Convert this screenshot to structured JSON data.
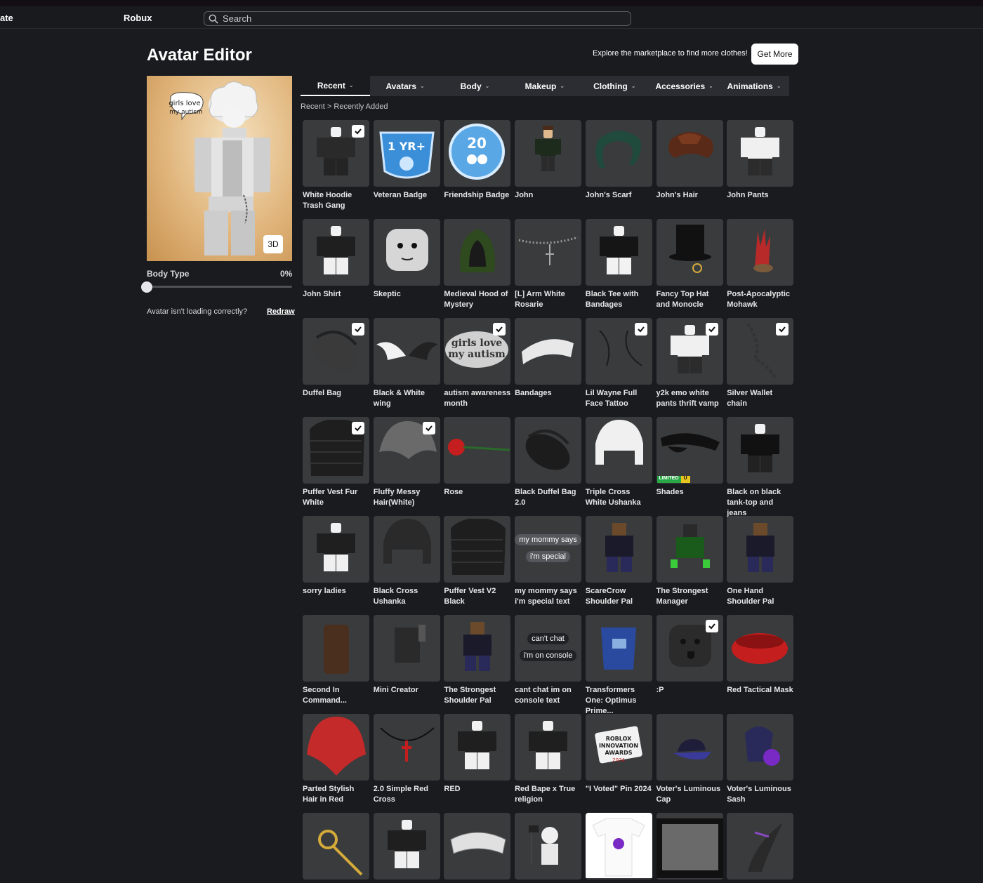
{
  "nav": {
    "left_fragment": "ate",
    "robux": "Robux",
    "search_placeholder": "Search"
  },
  "page": {
    "title": "Avatar Editor",
    "promo_text": "Explore the marketplace to find more clothes!",
    "get_more": "Get More"
  },
  "preview": {
    "button_3d": "3D",
    "sign_text": "girls love my autism",
    "body_type_label": "Body Type",
    "body_type_value": "0%",
    "loading_message": "Avatar isn't loading correctly?",
    "redraw": "Redraw"
  },
  "tabs": [
    {
      "label": "Recent",
      "active": true
    },
    {
      "label": "Avatars"
    },
    {
      "label": "Body"
    },
    {
      "label": "Makeup"
    },
    {
      "label": "Clothing"
    },
    {
      "label": "Accessories"
    },
    {
      "label": "Animations"
    }
  ],
  "breadcrumb": {
    "parent": "Recent",
    "separator": ">",
    "current": "Recently Added"
  },
  "items": [
    {
      "name": "White Hoodie Trash Gang",
      "icon": "hoodie-figure-icon",
      "checked": true
    },
    {
      "name": "Veteran Badge",
      "icon": "veteran-badge-icon",
      "badge_text": "1 YR+"
    },
    {
      "name": "Friendship Badge",
      "icon": "friendship-badge-icon",
      "badge_text": "20"
    },
    {
      "name": "John",
      "icon": "character-icon"
    },
    {
      "name": "John's Scarf",
      "icon": "scarf-icon"
    },
    {
      "name": "John's Hair",
      "icon": "hair-icon"
    },
    {
      "name": "John Pants",
      "icon": "pants-figure-icon"
    },
    {
      "name": "John Shirt",
      "icon": "shirt-figure-icon"
    },
    {
      "name": "Skeptic",
      "icon": "face-icon"
    },
    {
      "name": "Medieval Hood of Mystery",
      "icon": "hood-icon"
    },
    {
      "name": "[L] Arm White Rosarie",
      "icon": "rosary-icon"
    },
    {
      "name": "Black Tee with Bandages",
      "icon": "tee-figure-icon"
    },
    {
      "name": "Fancy Top Hat and Monocle",
      "icon": "top-hat-icon"
    },
    {
      "name": "Post-Apocalyptic Mohawk",
      "icon": "mohawk-icon"
    },
    {
      "name": "Duffel Bag",
      "icon": "duffel-bag-icon",
      "checked": true
    },
    {
      "name": "Black & White wing",
      "icon": "wings-icon"
    },
    {
      "name": "autism awareness month",
      "icon": "sign-text-icon",
      "checked": true,
      "sign_text": "girls love my autism"
    },
    {
      "name": "Bandages",
      "icon": "bandages-icon"
    },
    {
      "name": "Lil Wayne Full Face Tattoo",
      "icon": "tattoo-icon",
      "checked": true
    },
    {
      "name": "y2k emo white pants thrift vamp",
      "icon": "pants-figure-icon",
      "checked": true
    },
    {
      "name": "Silver Wallet chain",
      "icon": "chain-icon",
      "checked": true
    },
    {
      "name": "Puffer Vest Fur White",
      "icon": "puffer-vest-icon",
      "checked": true
    },
    {
      "name": "Fluffy Messy Hair(White)",
      "icon": "messy-hair-icon",
      "checked": true
    },
    {
      "name": "Rose",
      "icon": "rose-icon"
    },
    {
      "name": "Black Duffel Bag 2.0",
      "icon": "duffel-bag-icon"
    },
    {
      "name": "Triple Cross White Ushanka",
      "icon": "ushanka-icon"
    },
    {
      "name": "Shades",
      "icon": "shades-icon",
      "limited": "LIMITED",
      "limited_u": "U"
    },
    {
      "name": "Black on black tank-top and jeans",
      "icon": "tanktop-figure-icon"
    },
    {
      "name": "sorry ladies",
      "icon": "shirt-figure-icon"
    },
    {
      "name": "Black Cross Ushanka",
      "icon": "ushanka-icon"
    },
    {
      "name": "Puffer Vest V2 Black",
      "icon": "puffer-vest-icon"
    },
    {
      "name": "my mommy says i'm special text",
      "icon": "text-bubble-icon",
      "bubble1": "my mommy says",
      "bubble2": "i'm special"
    },
    {
      "name": "ScareCrow Shoulder Pal",
      "icon": "shoulder-pal-icon"
    },
    {
      "name": "The Strongest Manager",
      "icon": "manager-icon"
    },
    {
      "name": "One Hand Shoulder Pal",
      "icon": "shoulder-pal-icon"
    },
    {
      "name": "Second In Command...",
      "icon": "second-in-command-icon"
    },
    {
      "name": "Mini Creator",
      "icon": "mini-creator-icon"
    },
    {
      "name": "The Strongest Shoulder Pal",
      "icon": "shoulder-pal-icon"
    },
    {
      "name": "cant chat im on console text",
      "icon": "text-bubble-icon",
      "bubble1": "can't chat",
      "bubble2": "i'm on console"
    },
    {
      "name": "Transformers One: Optimus Prime...",
      "icon": "optimus-icon"
    },
    {
      "name": ":P",
      "icon": "face-icon",
      "checked": true
    },
    {
      "name": "Red Tactical Mask",
      "icon": "mask-icon"
    },
    {
      "name": "Parted Stylish Hair in Red",
      "icon": "red-hair-icon"
    },
    {
      "name": "2.0 Simple Red Cross",
      "icon": "cross-necklace-icon"
    },
    {
      "name": "RED",
      "icon": "shirt-figure-icon"
    },
    {
      "name": "Red Bape x True religion",
      "icon": "shirt-figure-icon"
    },
    {
      "name": "\"I Voted\" Pin 2024",
      "icon": "pin-icon",
      "pin_lines": [
        "ROBLOX",
        "INNOVATION",
        "AWARDS",
        "2024"
      ]
    },
    {
      "name": "Voter's Luminous Cap",
      "icon": "cap-icon"
    },
    {
      "name": "Voter's Luminous Sash",
      "icon": "sash-icon"
    },
    {
      "name": "",
      "icon": "staff-icon"
    },
    {
      "name": "",
      "icon": "shirt-figure-icon"
    },
    {
      "name": "",
      "icon": "banner-icon"
    },
    {
      "name": "",
      "icon": "astronaut-icon"
    },
    {
      "name": "",
      "icon": "tshirt-icon"
    },
    {
      "name": "",
      "icon": "tv-icon"
    },
    {
      "name": "",
      "icon": "claw-icon"
    }
  ]
}
